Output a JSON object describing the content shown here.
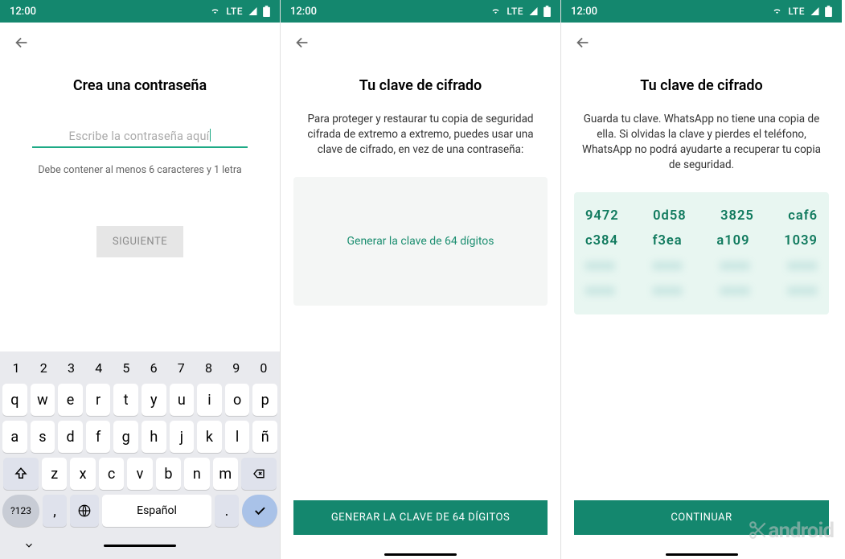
{
  "status": {
    "time": "12:00",
    "net": "LTE"
  },
  "screen1": {
    "title": "Crea una contraseña",
    "placeholder": "Escribe la contraseña aquí",
    "hint": "Debe contener al menos 6 caracteres y 1 letra",
    "next_btn": "SIGUIENTE",
    "keyboard": {
      "numbers": [
        "1",
        "2",
        "3",
        "4",
        "5",
        "6",
        "7",
        "8",
        "9",
        "0"
      ],
      "row2": [
        "q",
        "w",
        "e",
        "r",
        "t",
        "y",
        "u",
        "i",
        "o",
        "p"
      ],
      "row3": [
        "a",
        "s",
        "d",
        "f",
        "g",
        "h",
        "j",
        "k",
        "l",
        "ñ"
      ],
      "row4": [
        "z",
        "x",
        "c",
        "v",
        "b",
        "n",
        "m"
      ],
      "sym": "?123",
      "space": "Español",
      "comma": ",",
      "dot": "."
    }
  },
  "screen2": {
    "title": "Tu clave de cifrado",
    "desc": "Para proteger y restaurar tu copia de seguridad cifrada de extremo a extremo, puedes usar una clave de cifrado, en vez de una contraseña:",
    "gen_text": "Generar la clave de 64 dígitos",
    "bottom_btn": "GENERAR LA CLAVE DE 64 DÍGITOS"
  },
  "screen3": {
    "title": "Tu clave de cifrado",
    "desc": "Guarda tu clave. WhatsApp no tiene una copia de ella. Si olvidas la clave y pierdes el teléfono, WhatsApp no podrá ayudarte a recuperar tu copia de seguridad.",
    "key_lines": [
      [
        "9472",
        "0d58",
        "3825",
        "caf6"
      ],
      [
        "c384",
        "f3ea",
        "a109",
        "1039"
      ],
      [
        "xxxx",
        "xxxx",
        "xxxx",
        "xxxx"
      ],
      [
        "xxxx",
        "xxxx",
        "xxxx",
        "xxxx"
      ]
    ],
    "bottom_btn": "CONTINUAR"
  },
  "watermark": "android"
}
